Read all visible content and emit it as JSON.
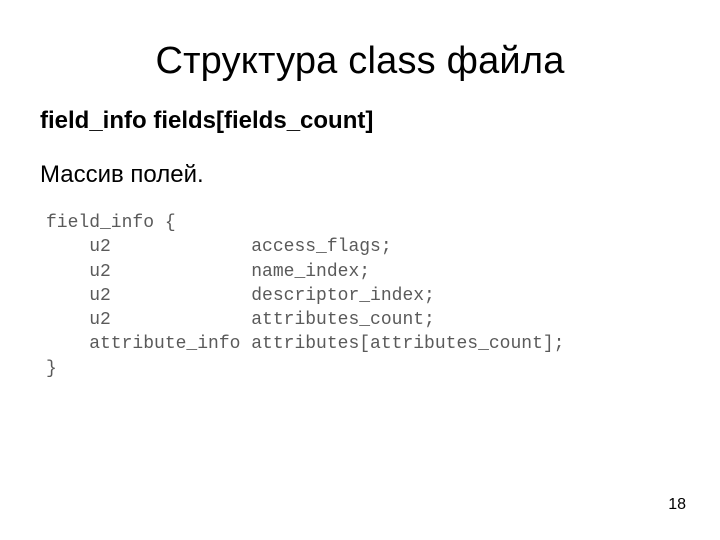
{
  "slide": {
    "title": "Структура class файла",
    "subtitle": "field_info fields[fields_count]",
    "paragraph": "Массив полей.",
    "page_number": "18"
  },
  "code": {
    "line1": "field_info {",
    "line2": "    u2             access_flags;",
    "line3": "    u2             name_index;",
    "line4": "    u2             descriptor_index;",
    "line5": "    u2             attributes_count;",
    "line6": "    attribute_info attributes[attributes_count];",
    "line7": "}"
  }
}
